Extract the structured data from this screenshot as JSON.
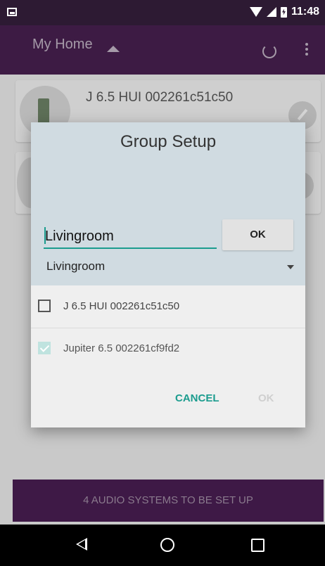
{
  "status_bar": {
    "time": "11:48"
  },
  "app_bar": {
    "title": "My Home"
  },
  "devices": [
    {
      "name": "J 6.5 HUI 002261c51c50"
    },
    {
      "name": ""
    }
  ],
  "setup_bar": {
    "label": "4 AUDIO SYSTEMS TO BE SET UP"
  },
  "dialog": {
    "title": "Group Setup",
    "name_input": {
      "value": "Livingroom",
      "placeholder": ""
    },
    "ok_small_label": "OK",
    "select_value": "Livingroom",
    "options": [
      {
        "label": "J 6.5 HUI 002261c51c50",
        "checked": false
      },
      {
        "label": "Jupiter 6.5 002261cf9fd2",
        "checked": true
      }
    ],
    "cancel_label": "CANCEL",
    "ok_label": "OK"
  },
  "colors": {
    "accent": "#1b9c8e",
    "primary_dark": "#3e1946"
  }
}
